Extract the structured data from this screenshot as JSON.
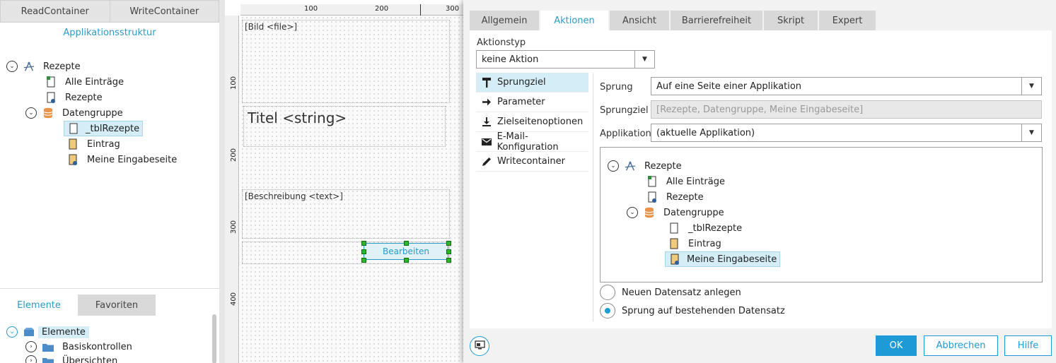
{
  "left_panel": {
    "tabs": [
      "ReadContainer",
      "WriteContainer"
    ],
    "title": "Applikationsstruktur",
    "tree": [
      {
        "label": "Rezepte"
      },
      {
        "label": "Alle Einträge"
      },
      {
        "label": "Rezepte"
      },
      {
        "label": "Datengruppe"
      },
      {
        "label": "_tblRezepte"
      },
      {
        "label": "Eintrag"
      },
      {
        "label": "Meine Eingabeseite"
      }
    ]
  },
  "bottom_panel": {
    "tabs": [
      "Elemente",
      "Favoriten"
    ],
    "tree": [
      {
        "label": "Elemente"
      },
      {
        "label": "Basiskontrollen"
      },
      {
        "label": "Übersichten"
      }
    ]
  },
  "canvas": {
    "ruler_h": [
      "100",
      "200",
      "300"
    ],
    "ruler_v": [
      "100",
      "200",
      "300",
      "400"
    ],
    "elements": {
      "image": "[Bild <file>]",
      "title": "Titel <string>",
      "description": "[Beschreibung <text>]",
      "button": "Bearbeiten"
    }
  },
  "dialog": {
    "tabs": [
      "Allgemein",
      "Aktionen",
      "Ansicht",
      "Barrierefreiheit",
      "Skript",
      "Expert"
    ],
    "active_tab": "Aktionen",
    "aktionstyp_label": "Aktionstyp",
    "aktionstyp_value": "keine Aktion",
    "sidenav": [
      {
        "label": "Sprungziel",
        "icon": "signpost-icon"
      },
      {
        "label": "Parameter",
        "icon": "arrow-right-icon"
      },
      {
        "label": "Zielseitenoptionen",
        "icon": "download-icon"
      },
      {
        "label": "E-Mail-Konfiguration",
        "icon": "mail-icon"
      },
      {
        "label": "Writecontainer",
        "icon": "pencil-icon"
      }
    ],
    "sprung_label": "Sprung",
    "sprung_value": "Auf eine Seite einer Applikation",
    "sprungziel_label": "Sprungziel",
    "sprungziel_value": "[Rezepte, Datengruppe, Meine Eingabeseite]",
    "applikation_label": "Applikation",
    "applikation_value": "(aktuelle Applikation)",
    "tree": [
      {
        "label": "Rezepte"
      },
      {
        "label": "Alle Einträge"
      },
      {
        "label": "Rezepte"
      },
      {
        "label": "Datengruppe"
      },
      {
        "label": "_tblRezepte"
      },
      {
        "label": "Eintrag"
      },
      {
        "label": "Meine Eingabeseite"
      }
    ],
    "radio_new": "Neuen Datensatz anlegen",
    "radio_existing": "Sprung auf bestehenden Datensatz",
    "radio_selected": "radio_existing",
    "buttons": {
      "ok": "OK",
      "cancel": "Abbrechen",
      "help": "Hilfe"
    }
  },
  "colors": {
    "accent": "#1e9bd7",
    "selection": "#d4edf7"
  }
}
